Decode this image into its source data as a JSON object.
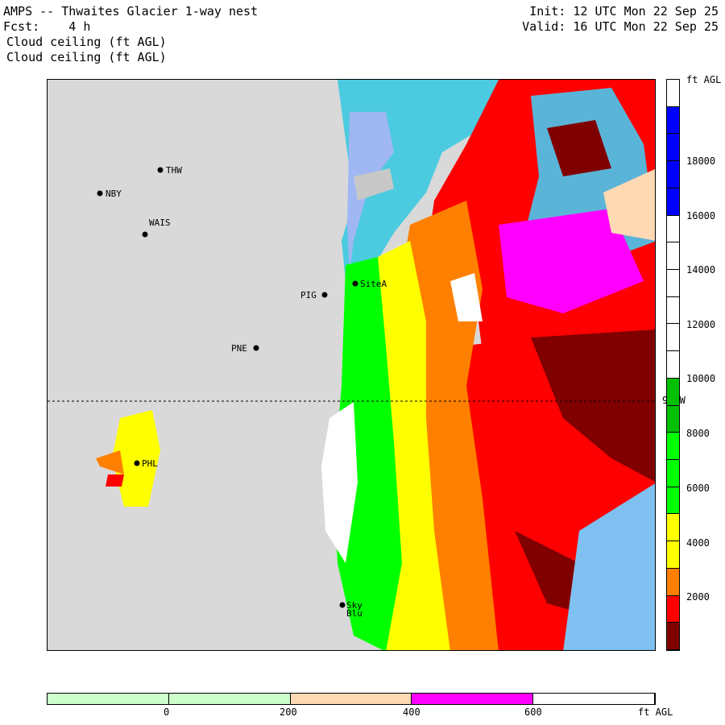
{
  "header": {
    "title": "AMPS -- Thwaites Glacier 1-way nest",
    "forecast": "Fcst:    4 h",
    "field_1": "Cloud ceiling (ft AGL)",
    "field_2": "Cloud ceiling (ft AGL)",
    "init": "Init: 12 UTC Mon 22 Sep 25",
    "valid": "Valid: 16 UTC Mon 22 Sep 25"
  },
  "map": {
    "meridian_label": "90 W",
    "stations": [
      "THW",
      "NBY",
      "WAIS",
      "PIG",
      "SiteA",
      "PNE",
      "PHL",
      "Sky",
      "Blu"
    ]
  },
  "colorbar": {
    "units": "ft AGL",
    "labels": [
      "18000",
      "16000",
      "14000",
      "12000",
      "10000",
      "8000",
      "6000",
      "4000",
      "2000"
    ],
    "colors": [
      "#ffffff",
      "#0000ff",
      "#0000ff",
      "#0000ff",
      "#0000ff",
      "#ffffff",
      "#ffffff",
      "#ffffff",
      "#ffffff",
      "#ffffff",
      "#ffffff",
      "#00c000",
      "#00c000",
      "#00ff00",
      "#00ff00",
      "#00ff00",
      "#ffff00",
      "#ffff00",
      "#ff8000",
      "#ff0000",
      "#800000"
    ]
  },
  "bottom_bar": {
    "units": "ft AGL",
    "labels": [
      "0",
      "200",
      "400",
      "600"
    ],
    "colors": [
      "#ccffcc",
      "#ccffcc",
      "#ffd9b3",
      "#ff00ff",
      "#ffffff"
    ]
  }
}
